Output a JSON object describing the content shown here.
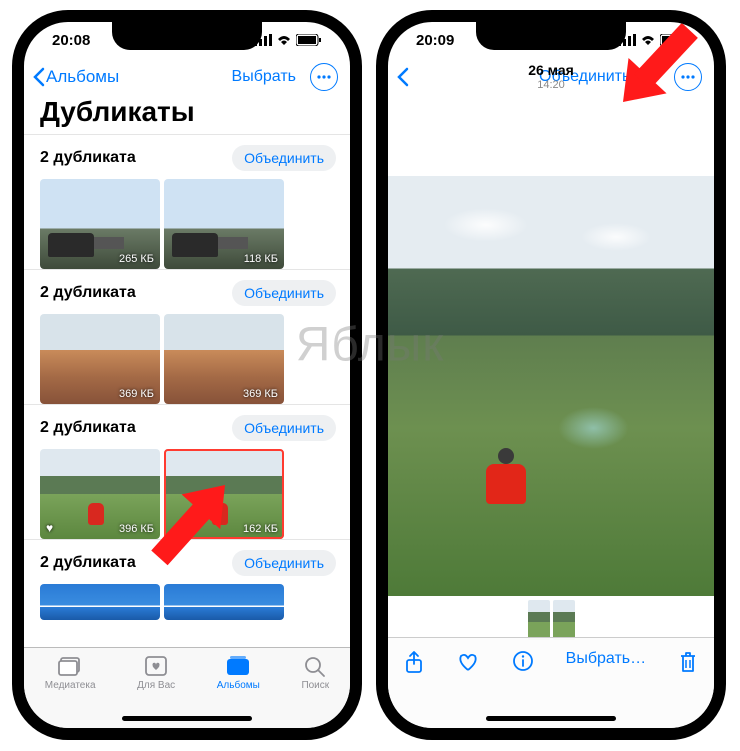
{
  "watermark": "Яблык",
  "left": {
    "status_time": "20:08",
    "back_label": "Альбомы",
    "select_label": "Выбрать",
    "title": "Дубликаты",
    "merge_label": "Объединить",
    "groups": [
      {
        "count_label": "2 дубликата",
        "thumbs": [
          {
            "size": "265 КБ"
          },
          {
            "size": "118 КБ"
          }
        ]
      },
      {
        "count_label": "2 дубликата",
        "thumbs": [
          {
            "size": "369 КБ"
          },
          {
            "size": "369 КБ"
          }
        ]
      },
      {
        "count_label": "2 дубликата",
        "thumbs": [
          {
            "size": "396 КБ",
            "favorite": true
          },
          {
            "size": "162 КБ",
            "selected": true
          }
        ]
      },
      {
        "count_label": "2 дубликата",
        "thumbs": [
          {
            "size": ""
          },
          {
            "size": ""
          }
        ]
      }
    ],
    "tabs": {
      "library": "Медиатека",
      "for_you": "Для Вас",
      "albums": "Альбомы",
      "search": "Поиск"
    }
  },
  "right": {
    "status_time": "20:09",
    "date_line1": "26 мая",
    "date_line2": "14:20",
    "merge_all": "Объединить все",
    "select_label": "Выбрать…"
  }
}
